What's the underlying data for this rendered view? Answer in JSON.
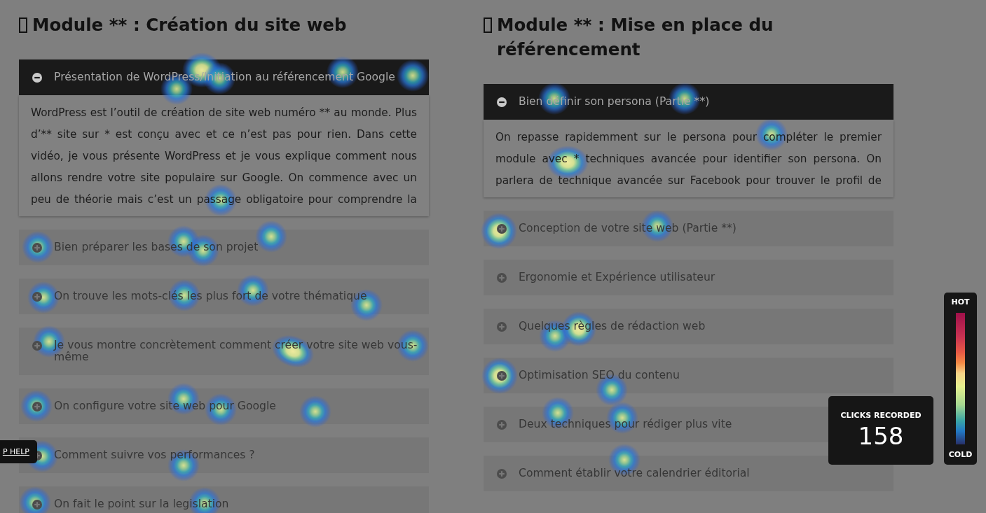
{
  "modules": [
    {
      "title": "Module ** : Création du site web",
      "lessons": [
        {
          "title": "Présentation de WordPress/Initiation au référencement Google",
          "expanded": true,
          "description": "WordPress est l’outil de création de site web numéro ** au monde. Plus d’** site sur * est conçu avec et ce n’est pas pour rien. Dans cette vidéo, je vous présente WordPress et je vous explique comment nous allons rendre votre site populaire sur Google. On commence avec un peu de théorie mais c’est un passage obligatoire pour comprendre la"
        },
        {
          "title": "Bien préparer les bases de son projet",
          "expanded": false
        },
        {
          "title": "On trouve les mots-clés les plus fort de votre thématique",
          "expanded": false
        },
        {
          "title": "Je vous montre concrètement comment créer votre site web vous-même",
          "expanded": false
        },
        {
          "title": "On configure votre site web pour Google",
          "expanded": false
        },
        {
          "title": "Comment suivre vos performances ?",
          "expanded": false
        },
        {
          "title": "On fait le point sur la legislation",
          "expanded": false
        }
      ]
    },
    {
      "title": "Module ** : Mise en place du référencement",
      "lessons": [
        {
          "title": "Bien définir son persona (Partie **)",
          "expanded": true,
          "description": "On repasse rapidemment sur le persona pour compléter le premier module avec * techniques avancée pour identifier son persona. On parlera de technique avancée sur Facebook pour trouver le profil de"
        },
        {
          "title": "Conception de votre site web (Partie **)",
          "expanded": false
        },
        {
          "title": "Ergonomie et Expérience utilisateur",
          "expanded": false
        },
        {
          "title": "Quelques règles de rédaction web",
          "expanded": false
        },
        {
          "title": "Optimisation SEO du contenu",
          "expanded": false
        },
        {
          "title": "Deux techniques pour rédiger plus vite",
          "expanded": false
        },
        {
          "title": "Comment établir votre calendrier éditorial",
          "expanded": false
        }
      ]
    }
  ],
  "help_button": {
    "label": "P HELP"
  },
  "clicks_recorded": {
    "label": "CLICKS RECORDED",
    "count": "158"
  },
  "heat_legend": {
    "top_label": "HOT",
    "bottom_label": "COLD"
  }
}
